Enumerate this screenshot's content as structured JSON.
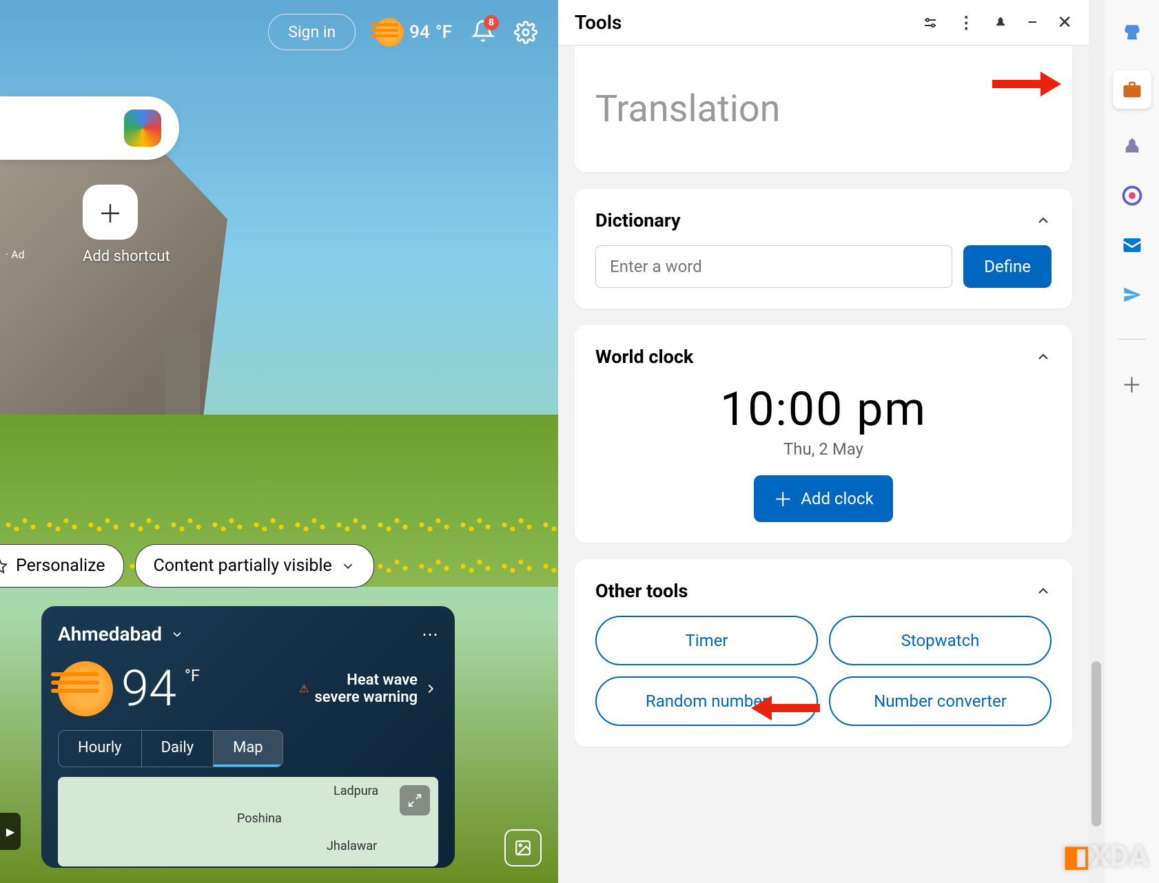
{
  "topbar": {
    "signin": "Sign in",
    "temp": "94",
    "unit": "°F",
    "badge": "8"
  },
  "shortcuts": {
    "add_label": "Add shortcut",
    "ad_tag": "· Ad"
  },
  "chips": {
    "personalize": "Personalize",
    "content": "Content partially visible"
  },
  "weather_card": {
    "location": "Ahmedabad",
    "temp": "94",
    "unit": "°F",
    "alert_line1": "Heat wave",
    "alert_line2": "severe warning",
    "tabs": {
      "hourly": "Hourly",
      "daily": "Daily",
      "map": "Map"
    },
    "map_labels": {
      "l1": "Ladpura",
      "l2": "Poshina",
      "l3": "Jhalawar"
    }
  },
  "tools": {
    "title": "Tools",
    "translation": {
      "placeholder": "Translation"
    },
    "dictionary": {
      "title": "Dictionary",
      "placeholder": "Enter a word",
      "button": "Define"
    },
    "clock": {
      "title": "World clock",
      "time": "10:00 pm",
      "date": "Thu, 2 May",
      "add": "Add clock"
    },
    "other": {
      "title": "Other tools",
      "timer": "Timer",
      "stopwatch": "Stopwatch",
      "random": "Random number",
      "converter": "Number converter"
    }
  },
  "watermark": "XDA"
}
